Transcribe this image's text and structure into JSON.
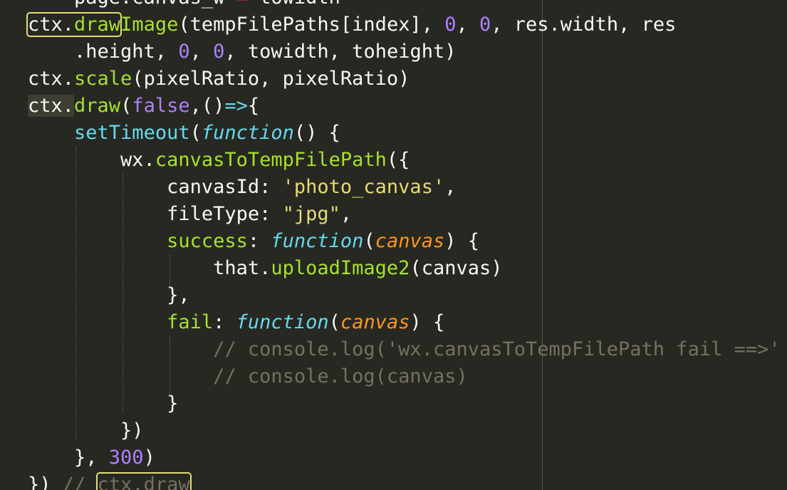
{
  "editor": {
    "theme_colors": {
      "background": "#272822",
      "plain": "#f8f8f2",
      "function": "#a6e22e",
      "number": "#ae81ff",
      "keyword": "#66d9ef",
      "param": "#fd971f",
      "string": "#e6db74",
      "comment": "#75715e",
      "highlight_box": "#e6db74"
    },
    "lines": [
      {
        "id": 0,
        "tokens": [
          [
            "plain",
            "    page.canvas_w "
          ],
          [
            "op",
            "="
          ],
          [
            "plain",
            " towidth"
          ]
        ]
      },
      {
        "id": 1,
        "tokens": [
          [
            "box",
            "ctx.draw"
          ],
          [
            "func",
            "Image"
          ],
          [
            "plain",
            "(tempFilePaths[index], "
          ],
          [
            "num",
            "0"
          ],
          [
            "plain",
            ", "
          ],
          [
            "num",
            "0"
          ],
          [
            "plain",
            ", res.width, res"
          ]
        ]
      },
      {
        "id": 2,
        "tokens": [
          [
            "plain",
            "    .height, "
          ],
          [
            "num",
            "0"
          ],
          [
            "plain",
            ", "
          ],
          [
            "num",
            "0"
          ],
          [
            "plain",
            ", towidth, toheight)"
          ]
        ]
      },
      {
        "id": 3,
        "tokens": [
          [
            "plain",
            "ctx."
          ],
          [
            "func",
            "scale"
          ],
          [
            "plain",
            "(pixelRatio, pixelRatio)"
          ]
        ]
      },
      {
        "id": 4,
        "tokens": [
          [
            "hl",
            "ctx."
          ],
          [
            "func",
            "draw"
          ],
          [
            "plain",
            "("
          ],
          [
            "bool",
            "false"
          ],
          [
            "plain",
            ",()"
          ],
          [
            "kw",
            "=>"
          ],
          [
            "plain",
            "{"
          ]
        ]
      },
      {
        "id": 5,
        "tokens": [
          [
            "plain",
            "    "
          ],
          [
            "kw",
            "setTimeout"
          ],
          [
            "plain",
            "("
          ],
          [
            "italic",
            "function"
          ],
          [
            "plain",
            "() {"
          ]
        ]
      },
      {
        "id": 6,
        "tokens": [
          [
            "plain",
            "        wx."
          ],
          [
            "func",
            "canvasToTempFilePath"
          ],
          [
            "plain",
            "({"
          ]
        ]
      },
      {
        "id": 7,
        "tokens": [
          [
            "plain",
            "            canvasId: "
          ],
          [
            "str",
            "'photo_canvas'"
          ],
          [
            "plain",
            ","
          ]
        ]
      },
      {
        "id": 8,
        "tokens": [
          [
            "plain",
            "            fileType: "
          ],
          [
            "str",
            "\"jpg\""
          ],
          [
            "plain",
            ","
          ]
        ]
      },
      {
        "id": 9,
        "tokens": [
          [
            "plain",
            "            "
          ],
          [
            "func",
            "success"
          ],
          [
            "plain",
            ": "
          ],
          [
            "italic",
            "function"
          ],
          [
            "plain",
            "("
          ],
          [
            "param",
            "canvas"
          ],
          [
            "plain",
            ") {"
          ]
        ]
      },
      {
        "id": 10,
        "tokens": [
          [
            "plain",
            "                that."
          ],
          [
            "func",
            "uploadImage2"
          ],
          [
            "plain",
            "(canvas)"
          ]
        ]
      },
      {
        "id": 11,
        "tokens": [
          [
            "plain",
            "            },"
          ]
        ]
      },
      {
        "id": 12,
        "tokens": [
          [
            "plain",
            "            "
          ],
          [
            "func",
            "fail"
          ],
          [
            "plain",
            ": "
          ],
          [
            "italic",
            "function"
          ],
          [
            "plain",
            "("
          ],
          [
            "param",
            "canvas"
          ],
          [
            "plain",
            ") {"
          ]
        ]
      },
      {
        "id": 13,
        "tokens": [
          [
            "plain",
            "                "
          ],
          [
            "comment",
            "// console.log('wx.canvasToTempFilePath fail ==>'"
          ]
        ]
      },
      {
        "id": 14,
        "tokens": [
          [
            "plain",
            "                "
          ],
          [
            "comment",
            "// console.log(canvas)"
          ]
        ]
      },
      {
        "id": 15,
        "tokens": [
          [
            "plain",
            "            }"
          ]
        ]
      },
      {
        "id": 16,
        "tokens": [
          [
            "plain",
            "        })"
          ]
        ]
      },
      {
        "id": 17,
        "tokens": [
          [
            "plain",
            "    }, "
          ],
          [
            "num",
            "300"
          ],
          [
            "plain",
            ")"
          ]
        ]
      },
      {
        "id": 18,
        "tokens": [
          [
            "plain",
            "}) "
          ],
          [
            "comment",
            "// "
          ],
          [
            "boxc",
            "ctx.draw"
          ]
        ]
      }
    ]
  }
}
